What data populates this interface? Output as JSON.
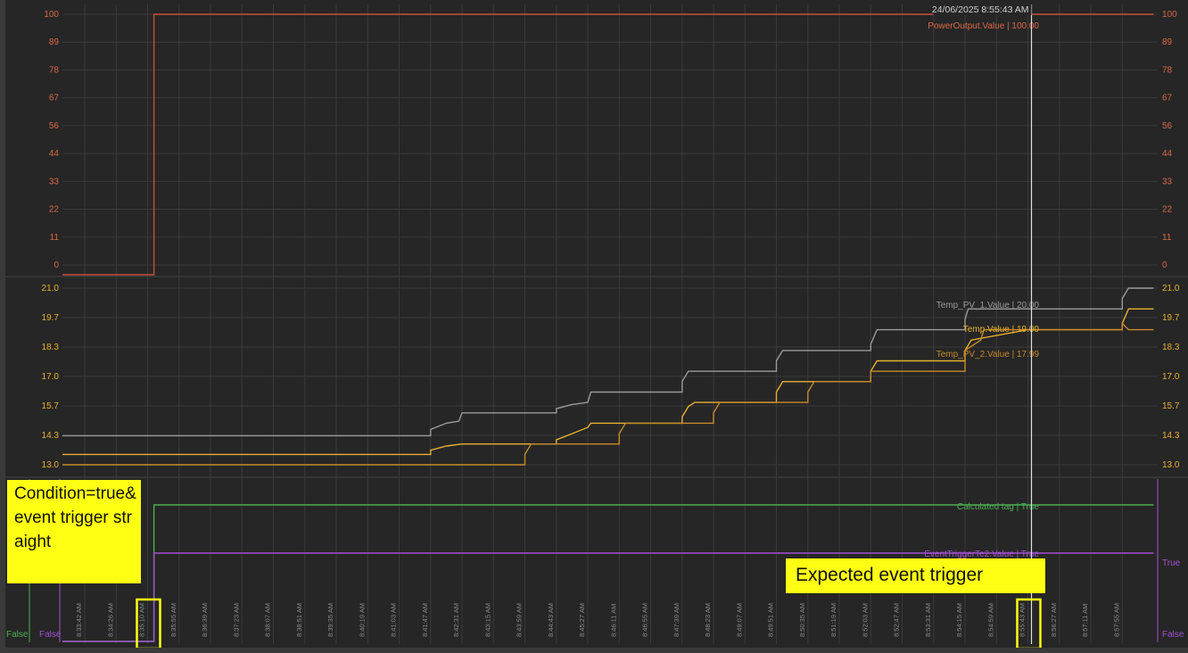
{
  "timestamp_label": "24/06/2025 8:55:43 AM",
  "chart_data": {
    "type": "line",
    "x_ticks": [
      "8:33:42 AM",
      "8:34:26 AM",
      "8:35:10 AM",
      "8:35:55 AM",
      "8:36:39 AM",
      "8:37:23 AM",
      "8:38:07 AM",
      "8:38:51 AM",
      "8:39:35 AM",
      "8:40:19 AM",
      "8:41:03 AM",
      "8:41:47 AM",
      "8:42:31 AM",
      "8:43:15 AM",
      "8:43:59 AM",
      "8:44:43 AM",
      "8:45:27 AM",
      "8:46:11 AM",
      "8:46:55 AM",
      "8:47:39 AM",
      "8:48:23 AM",
      "8:49:07 AM",
      "8:49:51 AM",
      "8:50:35 AM",
      "8:51:19 AM",
      "8:52:03 AM",
      "8:52:47 AM",
      "8:53:31 AM",
      "8:54:15 AM",
      "8:54:59 AM",
      "8:55:43 AM",
      "8:56:27 AM",
      "8:57:11 AM",
      "8:57:55 AM"
    ],
    "highlighted_ticks": [
      "8:35:10 AM",
      "8:55:43 AM"
    ],
    "cursor_tick": "8:55:43 AM",
    "panels": [
      {
        "id": "power",
        "y_ticks": [
          "100",
          "89",
          "78",
          "67",
          "56",
          "44",
          "33",
          "22",
          "11",
          "0"
        ],
        "ylim": [
          0,
          100
        ],
        "series": [
          {
            "name": "PowerOutput.Value",
            "label": "PowerOutput.Value | 100.00",
            "color": "#c8503c",
            "points": [
              [
                0,
                -1
              ],
              [
                2.2,
                -1
              ],
              [
                2.2,
                100
              ],
              [
                34,
                100
              ]
            ]
          }
        ]
      },
      {
        "id": "temperature",
        "y_ticks": [
          "21.0",
          "19.7",
          "18.3",
          "17.0",
          "15.7",
          "14.3",
          "13.0"
        ],
        "ylim": [
          12.5,
          21.0
        ],
        "series": [
          {
            "name": "Temp_PV_1.Value",
            "label": "Temp_PV_1.Value | 20.00",
            "color": "#9a9a9a",
            "points": [
              [
                0,
                13.9
              ],
              [
                11.0,
                13.9
              ],
              [
                11.0,
                14.2
              ],
              [
                11.5,
                14.5
              ],
              [
                11.9,
                14.6
              ],
              [
                12.0,
                15.0
              ],
              [
                15.0,
                15.0
              ],
              [
                15.0,
                15.2
              ],
              [
                15.5,
                15.4
              ],
              [
                16.0,
                15.5
              ],
              [
                16.1,
                16.0
              ],
              [
                19.0,
                16.0
              ],
              [
                19.0,
                16.5
              ],
              [
                19.2,
                17.0
              ],
              [
                22.0,
                17.0
              ],
              [
                22.0,
                17.5
              ],
              [
                22.2,
                18.0
              ],
              [
                25.0,
                18.0
              ],
              [
                25.0,
                18.3
              ],
              [
                25.2,
                19.0
              ],
              [
                28.0,
                19.0
              ],
              [
                28.0,
                19.5
              ],
              [
                28.1,
                20.0
              ],
              [
                33.0,
                20.0
              ],
              [
                33.0,
                20.5
              ],
              [
                33.2,
                21.0
              ],
              [
                34,
                21.0
              ]
            ]
          },
          {
            "name": "Temp.Value",
            "label": "Temp.Value | 19.00",
            "color": "#e8b030",
            "points": [
              [
                0,
                13.0
              ],
              [
                11.0,
                13.0
              ],
              [
                11.0,
                13.2
              ],
              [
                11.5,
                13.4
              ],
              [
                12.0,
                13.5
              ],
              [
                15.0,
                13.5
              ],
              [
                15.0,
                13.7
              ],
              [
                15.5,
                14.0
              ],
              [
                16.0,
                14.3
              ],
              [
                16.1,
                14.5
              ],
              [
                19.0,
                14.5
              ],
              [
                19.0,
                14.8
              ],
              [
                19.2,
                15.3
              ],
              [
                19.4,
                15.5
              ],
              [
                22.0,
                15.5
              ],
              [
                22.0,
                16.0
              ],
              [
                22.2,
                16.5
              ],
              [
                25.0,
                16.5
              ],
              [
                25.0,
                17.0
              ],
              [
                25.2,
                17.5
              ],
              [
                28.0,
                17.5
              ],
              [
                28.0,
                18.0
              ],
              [
                28.2,
                18.5
              ],
              [
                30.0,
                19.0
              ],
              [
                33.0,
                19.0
              ],
              [
                33.0,
                19.3
              ],
              [
                33.2,
                20.0
              ],
              [
                34,
                20.0
              ]
            ]
          },
          {
            "name": "Temp_PV_2.Value",
            "label": "Temp_PV_2.Value | 17.99",
            "color": "#c88a2a",
            "points": [
              [
                0,
                12.5
              ],
              [
                14.0,
                12.5
              ],
              [
                14.0,
                13.0
              ],
              [
                14.2,
                13.5
              ],
              [
                17.0,
                13.5
              ],
              [
                17.0,
                14.0
              ],
              [
                17.2,
                14.5
              ],
              [
                20.0,
                14.5
              ],
              [
                20.0,
                15.0
              ],
              [
                20.2,
                15.5
              ],
              [
                23.0,
                15.5
              ],
              [
                23.0,
                16.0
              ],
              [
                23.2,
                16.5
              ],
              [
                25.0,
                16.5
              ],
              [
                25.0,
                17.0
              ],
              [
                27.5,
                17.0
              ],
              [
                28.0,
                17.0
              ],
              [
                28.0,
                18.0
              ],
              [
                28.5,
                18.5
              ],
              [
                28.6,
                19.0
              ],
              [
                30.0,
                19.0
              ],
              [
                33.0,
                19.0
              ],
              [
                33.0,
                19.3
              ],
              [
                33.2,
                19.0
              ],
              [
                34,
                19.0
              ]
            ]
          }
        ]
      },
      {
        "id": "boolean",
        "y_ticks_left": [
          "False",
          "False"
        ],
        "y_ticks_right": [
          "True",
          "False"
        ],
        "series": [
          {
            "name": "Calculated tag",
            "label": "Calculated tag | True",
            "color": "#4caf50",
            "points": [
              [
                0,
                0
              ],
              [
                2.2,
                0
              ],
              [
                2.2,
                1
              ],
              [
                34,
                1
              ]
            ]
          },
          {
            "name": "EventTriggerTe2.Value",
            "label": "EventTriggerTe2.Value | True",
            "color": "#a050d0",
            "points": [
              [
                0,
                0
              ],
              [
                2.2,
                0
              ],
              [
                2.2,
                1
              ],
              [
                34,
                1
              ]
            ]
          }
        ]
      }
    ]
  },
  "annotations": {
    "left": "Condition=true& event trigger straight",
    "right": "Expected event trigger"
  }
}
